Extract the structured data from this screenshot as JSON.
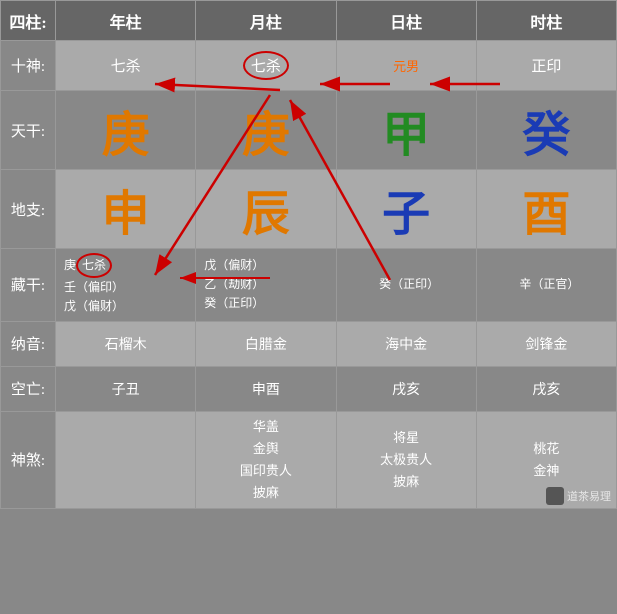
{
  "header": {
    "col0": "四柱:",
    "col1": "年柱",
    "col2": "月柱",
    "col3": "日柱",
    "col4": "时柱"
  },
  "rows": {
    "shishen": {
      "label": "十神:",
      "nian": "七杀",
      "yue": "七杀",
      "ri": "元男",
      "shi": "正印"
    },
    "tiangan": {
      "label": "天干:",
      "nian": "庚",
      "yue": "庚",
      "ri": "甲",
      "shi": "癸"
    },
    "dizhi": {
      "label": "地支:",
      "nian": "申",
      "yue": "辰",
      "ri": "子",
      "shi": "酉"
    },
    "zanggan": {
      "label": "藏干:",
      "nian": "庚（七杀）\n壬（偏印）\n戊（偏财）",
      "yue": "戊（偏财）\n乙（劫财）\n癸（正印）",
      "ri": "癸（正印）",
      "shi": "辛（正官）"
    },
    "nayin": {
      "label": "纳音:",
      "nian": "石榴木",
      "yue": "白腊金",
      "ri": "海中金",
      "shi": "剑锋金"
    },
    "kongwang": {
      "label": "空亡:",
      "nian": "子丑",
      "yue": "申酉",
      "ri": "戌亥",
      "shi": "戌亥"
    },
    "shensha": {
      "label": "神煞:",
      "nian": "",
      "yue": "华盖\n金舆\n国印贵人\n披麻",
      "ri": "将星\n太极贵人\n披麻",
      "shi": "桃花\n金神"
    }
  },
  "watermark": "道茶易理"
}
